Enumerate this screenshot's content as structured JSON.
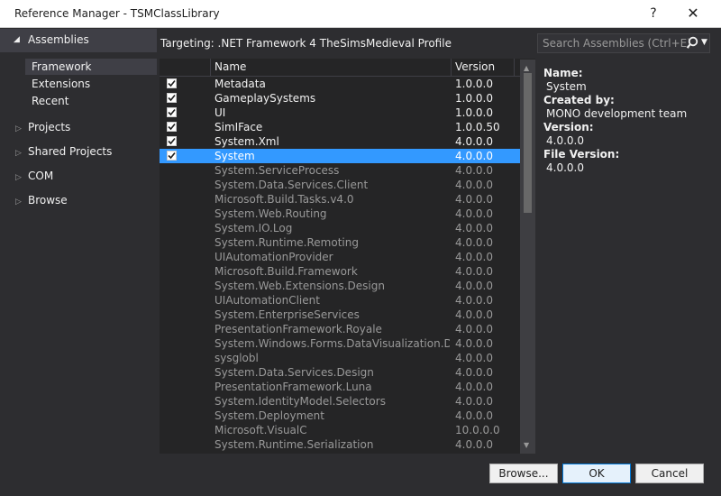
{
  "window": {
    "title": "Reference Manager - TSMClassLibrary",
    "help": "?",
    "close": "✕"
  },
  "sidebar": {
    "section": "Assemblies",
    "sub_items": [
      "Framework",
      "Extensions",
      "Recent"
    ],
    "groups": [
      "Projects",
      "Shared Projects",
      "COM",
      "Browse"
    ]
  },
  "targeting": "Targeting: .NET Framework 4 TheSimsMedieval Profile",
  "search": {
    "placeholder": "Search Assemblies (Ctrl+E)"
  },
  "table": {
    "columns": [
      "Name",
      "Version"
    ],
    "rows": [
      {
        "name": "Metadata",
        "version": "1.0.0.0",
        "checked": true
      },
      {
        "name": "GameplaySystems",
        "version": "1.0.0.0",
        "checked": true
      },
      {
        "name": "UI",
        "version": "1.0.0.0",
        "checked": true
      },
      {
        "name": "SimIFace",
        "version": "1.0.0.50",
        "checked": true
      },
      {
        "name": "System.Xml",
        "version": "4.0.0.0",
        "checked": true
      },
      {
        "name": "System",
        "version": "4.0.0.0",
        "checked": true,
        "selected": true
      },
      {
        "name": "System.ServiceProcess",
        "version": "4.0.0.0",
        "checked": false
      },
      {
        "name": "System.Data.Services.Client",
        "version": "4.0.0.0",
        "checked": false
      },
      {
        "name": "Microsoft.Build.Tasks.v4.0",
        "version": "4.0.0.0",
        "checked": false
      },
      {
        "name": "System.Web.Routing",
        "version": "4.0.0.0",
        "checked": false
      },
      {
        "name": "System.IO.Log",
        "version": "4.0.0.0",
        "checked": false
      },
      {
        "name": "System.Runtime.Remoting",
        "version": "4.0.0.0",
        "checked": false
      },
      {
        "name": "UIAutomationProvider",
        "version": "4.0.0.0",
        "checked": false
      },
      {
        "name": "Microsoft.Build.Framework",
        "version": "4.0.0.0",
        "checked": false
      },
      {
        "name": "System.Web.Extensions.Design",
        "version": "4.0.0.0",
        "checked": false
      },
      {
        "name": "UIAutomationClient",
        "version": "4.0.0.0",
        "checked": false
      },
      {
        "name": "System.EnterpriseServices",
        "version": "4.0.0.0",
        "checked": false
      },
      {
        "name": "PresentationFramework.Royale",
        "version": "4.0.0.0",
        "checked": false
      },
      {
        "name": "System.Windows.Forms.DataVisualization.Desi...",
        "version": "4.0.0.0",
        "checked": false
      },
      {
        "name": "sysglobl",
        "version": "4.0.0.0",
        "checked": false
      },
      {
        "name": "System.Data.Services.Design",
        "version": "4.0.0.0",
        "checked": false
      },
      {
        "name": "PresentationFramework.Luna",
        "version": "4.0.0.0",
        "checked": false
      },
      {
        "name": "System.IdentityModel.Selectors",
        "version": "4.0.0.0",
        "checked": false
      },
      {
        "name": "System.Deployment",
        "version": "4.0.0.0",
        "checked": false
      },
      {
        "name": "Microsoft.VisualC",
        "version": "10.0.0.0",
        "checked": false
      },
      {
        "name": "System.Runtime.Serialization",
        "version": "4.0.0.0",
        "checked": false
      }
    ]
  },
  "details": [
    {
      "label": "Name:",
      "value": "System"
    },
    {
      "label": "Created by:",
      "value": "MONO development team"
    },
    {
      "label": "Version:",
      "value": "4.0.0.0"
    },
    {
      "label": "File Version:",
      "value": "4.0.0.0"
    }
  ],
  "buttons": {
    "browse": "Browse...",
    "ok": "OK",
    "cancel": "Cancel"
  },
  "colors": {
    "selection": "#3399ff",
    "background": "#2d2d30",
    "list_bg": "#252526"
  }
}
